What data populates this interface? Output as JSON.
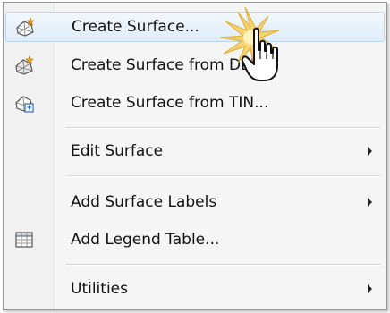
{
  "menu": {
    "items": [
      {
        "label": "Create Surface...",
        "icon": "surface-star-icon",
        "submenu": false,
        "hover": true
      },
      {
        "label": "Create Surface from DEM...",
        "icon": "surface-star-icon",
        "submenu": false,
        "hover": false
      },
      {
        "label": "Create Surface from TIN...",
        "icon": "surface-import-icon",
        "submenu": false,
        "hover": false
      },
      {
        "label": "Edit Surface",
        "icon": "",
        "submenu": true,
        "hover": false
      },
      {
        "label": "Add Surface Labels",
        "icon": "",
        "submenu": true,
        "hover": false
      },
      {
        "label": "Add Legend Table...",
        "icon": "table-icon",
        "submenu": false,
        "hover": false
      },
      {
        "label": "Utilities",
        "icon": "",
        "submenu": true,
        "hover": false
      }
    ]
  },
  "colors": {
    "hover_background": "#dfecf9",
    "hover_border": "#b9d4f1",
    "burst": "#f5d36a"
  }
}
